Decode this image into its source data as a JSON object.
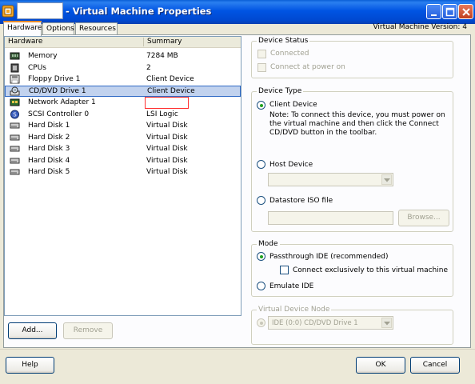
{
  "window": {
    "title": "- Virtual Machine Properties",
    "vm_version": "Virtual Machine Version: 4"
  },
  "tabs": [
    "Hardware",
    "Options",
    "Resources"
  ],
  "hardware": {
    "col_hardware": "Hardware",
    "col_summary": "Summary",
    "items": [
      {
        "name": "Memory",
        "summary": "7284 MB",
        "icon": "memory-icon"
      },
      {
        "name": "CPUs",
        "summary": "2",
        "icon": "cpu-icon"
      },
      {
        "name": "Floppy Drive 1",
        "summary": "Client Device",
        "icon": "floppy-icon"
      },
      {
        "name": "CD/DVD Drive 1",
        "summary": "Client Device",
        "icon": "cd-dvd-icon",
        "selected": true
      },
      {
        "name": "Network Adapter 1",
        "summary": "",
        "icon": "network-adapter-icon"
      },
      {
        "name": "SCSI Controller 0",
        "summary": "LSI Logic",
        "icon": "scsi-icon"
      },
      {
        "name": "Hard Disk 1",
        "summary": "Virtual Disk",
        "icon": "hard-disk-icon"
      },
      {
        "name": "Hard Disk 2",
        "summary": "Virtual Disk",
        "icon": "hard-disk-icon"
      },
      {
        "name": "Hard Disk 3",
        "summary": "Virtual Disk",
        "icon": "hard-disk-icon"
      },
      {
        "name": "Hard Disk 4",
        "summary": "Virtual Disk",
        "icon": "hard-disk-icon"
      },
      {
        "name": "Hard Disk 5",
        "summary": "Virtual Disk",
        "icon": "hard-disk-icon"
      }
    ],
    "add_label": "Add...",
    "remove_label": "Remove"
  },
  "device_status": {
    "title": "Device Status",
    "connected": "Connected",
    "connect_power": "Connect at power on"
  },
  "device_type": {
    "title": "Device Type",
    "client_device": "Client Device",
    "note": "Note: To connect this device, you must power on the virtual machine and then click the Connect CD/DVD button in the toolbar.",
    "host_device": "Host Device",
    "datastore_iso": "Datastore ISO file",
    "browse_label": "Browse..."
  },
  "mode": {
    "title": "Mode",
    "passthrough": "Passthrough IDE (recommended)",
    "connect_exclusive": "Connect exclusively to this virtual machine",
    "emulate": "Emulate IDE"
  },
  "virtual_device_node": {
    "title": "Virtual Device Node",
    "value": "IDE (0:0) CD/DVD Drive 1"
  },
  "footer": {
    "help_label": "Help",
    "ok_label": "OK",
    "cancel_label": "Cancel"
  }
}
